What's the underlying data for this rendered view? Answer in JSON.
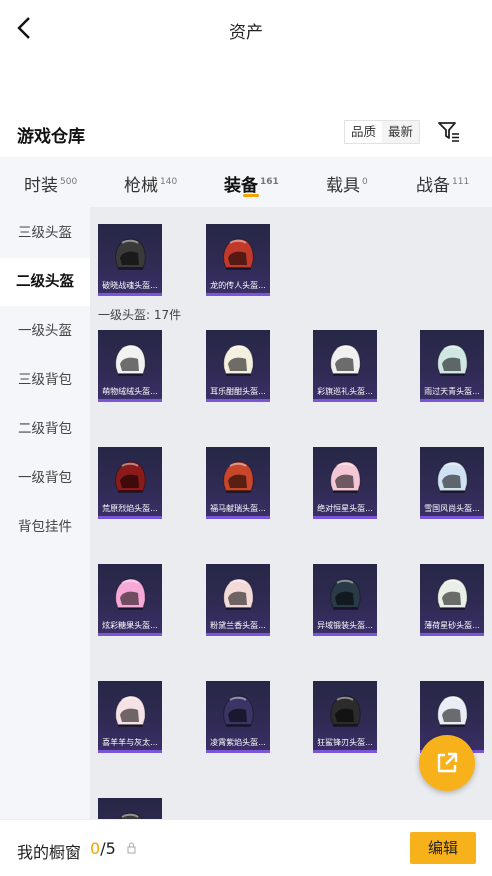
{
  "header": {
    "title": "资产"
  },
  "section": {
    "title": "游戏仓库",
    "sort": [
      "品质",
      "最新"
    ]
  },
  "tabs": [
    {
      "label": "时装",
      "count": "500"
    },
    {
      "label": "枪械",
      "count": "140"
    },
    {
      "label": "装备",
      "count": "161"
    },
    {
      "label": "载具",
      "count": "0"
    },
    {
      "label": "战备",
      "count": "111"
    }
  ],
  "sidebar": [
    "三级头盔",
    "二级头盔",
    "一级头盔",
    "三级背包",
    "二级背包",
    "一级背包",
    "背包挂件"
  ],
  "grid": {
    "top_items": [
      {
        "name": "破晓战魂头盔...",
        "color": "#3a3a3a"
      },
      {
        "name": "龙的传人头盔...",
        "color": "#c0392b"
      }
    ],
    "subheader": "一级头盔: 17件",
    "items": [
      {
        "name": "萌物绒绒头盔...",
        "color": "#f2f2f2"
      },
      {
        "name": "耳乐酣酣头盔...",
        "color": "#f5efe0"
      },
      {
        "name": "彩旗巡礼头盔...",
        "color": "#f0f0f0"
      },
      {
        "name": "雨过天青头盔...",
        "color": "#cfe6e2"
      },
      {
        "name": "荒原烈焰头盔...",
        "color": "#8b1a1a"
      },
      {
        "name": "福马献瑞头盔...",
        "color": "#c8462b"
      },
      {
        "name": "绝对恒星头盔...",
        "color": "#f4c6d6"
      },
      {
        "name": "雪国风尚头盔...",
        "color": "#cfe1f2"
      },
      {
        "name": "炫彩糖果头盔...",
        "color": "#f6a9d6"
      },
      {
        "name": "粉黛兰香头盔...",
        "color": "#f3dad9"
      },
      {
        "name": "异域锻装头盔...",
        "color": "#2a3a46"
      },
      {
        "name": "薄荷星砂头盔...",
        "color": "#e8efe6"
      },
      {
        "name": "喜羊羊与灰太...",
        "color": "#f5e1e6"
      },
      {
        "name": "凌霄紫焰头盔...",
        "color": "#3b3566"
      },
      {
        "name": "狂鲨锋刃头盔...",
        "color": "#2c2c2c"
      },
      {
        "name": "",
        "color": "#e9eef6"
      },
      {
        "name": "",
        "color": "#3a3a3a"
      }
    ]
  },
  "showcase": {
    "label": "我的橱窗",
    "current": "0",
    "total": "/5"
  },
  "edit_label": "编辑"
}
